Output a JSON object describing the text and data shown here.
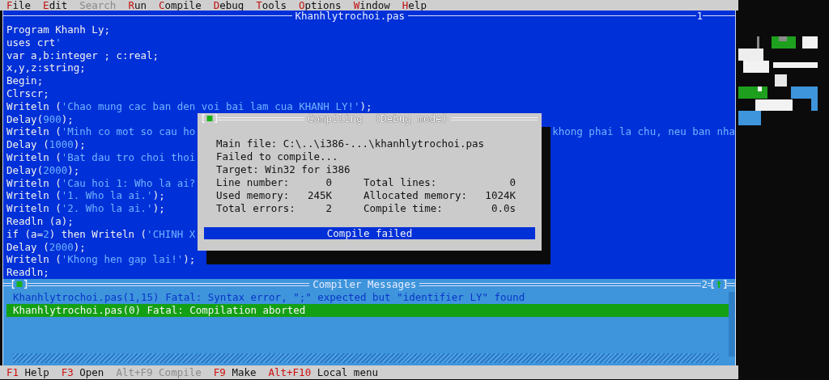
{
  "menu": [
    {
      "key": "F",
      "rest": "ile",
      "disabled": false
    },
    {
      "key": "E",
      "rest": "dit",
      "disabled": false
    },
    {
      "key": "S",
      "rest": "earch",
      "disabled": true
    },
    {
      "key": "R",
      "rest": "un",
      "disabled": false
    },
    {
      "key": "C",
      "rest": "ompile",
      "disabled": false
    },
    {
      "key": "D",
      "rest": "ebug",
      "disabled": false
    },
    {
      "key": "T",
      "rest": "ools",
      "disabled": false
    },
    {
      "key": "O",
      "rest": "ptions",
      "disabled": false
    },
    {
      "key": "W",
      "rest": "indow",
      "disabled": false
    },
    {
      "key": "H",
      "rest": "elp",
      "disabled": false
    }
  ],
  "editor": {
    "title": "Khanhlytrochoi.pas",
    "number": "1",
    "lines": [
      {
        "parts": [
          {
            "kind": "code",
            "text": "Program Khanh Ly;"
          }
        ]
      },
      {
        "parts": [
          {
            "kind": "code",
            "text": "uses crt"
          },
          {
            "kind": "literal",
            "text": "'"
          }
        ]
      },
      {
        "parts": [
          {
            "kind": "code",
            "text": "var a,b:integer ; c:real;"
          }
        ]
      },
      {
        "parts": [
          {
            "kind": "code",
            "text": "x,y,z:string;"
          }
        ]
      },
      {
        "parts": [
          {
            "kind": "code",
            "text": "Begin;"
          }
        ]
      },
      {
        "parts": [
          {
            "kind": "code",
            "text": "Clrscr;"
          }
        ]
      },
      {
        "parts": [
          {
            "kind": "code",
            "text": "Writeln ("
          },
          {
            "kind": "literal",
            "text": "'Chao mung cac ban den voi bai lam cua KHANH LY!'"
          },
          {
            "kind": "code",
            "text": ");"
          }
        ]
      },
      {
        "parts": [
          {
            "kind": "code",
            "text": "Delay("
          },
          {
            "kind": "literal",
            "text": "900"
          },
          {
            "kind": "code",
            "text": ");"
          }
        ]
      },
      {
        "parts": [
          {
            "kind": "code",
            "text": "Writeln ("
          },
          {
            "kind": "literal",
            "text": "'Minh co mot so cau ho"
          }
        ],
        "tail": "khong phai la chu, neu ban nha"
      },
      {
        "parts": [
          {
            "kind": "code",
            "text": "Delay ("
          },
          {
            "kind": "literal",
            "text": "1000"
          },
          {
            "kind": "code",
            "text": ");"
          }
        ]
      },
      {
        "parts": [
          {
            "kind": "code",
            "text": "Writeln ("
          },
          {
            "kind": "literal",
            "text": "'Bat dau tro choi thoi"
          }
        ]
      },
      {
        "parts": [
          {
            "kind": "code",
            "text": "Delay("
          },
          {
            "kind": "literal",
            "text": "2000"
          },
          {
            "kind": "code",
            "text": ");"
          }
        ]
      },
      {
        "parts": [
          {
            "kind": "code",
            "text": "Writeln ("
          },
          {
            "kind": "literal",
            "text": "'Cau hoi 1: Who la ai?"
          }
        ]
      },
      {
        "parts": [
          {
            "kind": "code",
            "text": "Writeln ("
          },
          {
            "kind": "literal",
            "text": "'1. Who la ai.'"
          },
          {
            "kind": "code",
            "text": ");"
          }
        ]
      },
      {
        "parts": [
          {
            "kind": "code",
            "text": "Writeln ("
          },
          {
            "kind": "literal",
            "text": "'2. Who la ai.'"
          },
          {
            "kind": "code",
            "text": ");"
          }
        ]
      },
      {
        "parts": [
          {
            "kind": "code",
            "text": "Readln (a);"
          }
        ]
      },
      {
        "parts": [
          {
            "kind": "code",
            "text": "if (a="
          },
          {
            "kind": "literal",
            "text": "2"
          },
          {
            "kind": "code",
            "text": ") then Writeln ("
          },
          {
            "kind": "literal",
            "text": "'CHINH X"
          }
        ]
      },
      {
        "parts": [
          {
            "kind": "code",
            "text": "Delay ("
          },
          {
            "kind": "literal",
            "text": "2000"
          },
          {
            "kind": "code",
            "text": ");"
          }
        ]
      },
      {
        "parts": [
          {
            "kind": "code",
            "text": "Writeln ("
          },
          {
            "kind": "literal",
            "text": "'Khong hen gap lai!'"
          },
          {
            "kind": "code",
            "text": ");"
          }
        ]
      },
      {
        "parts": [
          {
            "kind": "code",
            "text": "Readln;"
          }
        ]
      }
    ]
  },
  "dialog": {
    "title": "Compiling  (Debug mode)",
    "lines": [
      "Main file: C:\\..\\i386-...\\khanhlytrochoi.pas",
      "Failed to compile...",
      "Target: Win32 for i386"
    ],
    "stats": [
      {
        "label": "Line number:",
        "value": "0"
      },
      {
        "label": "Total lines:",
        "value": "0"
      },
      {
        "label": "Used memory:",
        "value": "245K"
      },
      {
        "label": "Allocated memory:",
        "value": "1024K"
      },
      {
        "label": "Total errors:",
        "value": "2"
      },
      {
        "label": "Compile time:",
        "value": "0.0s"
      }
    ],
    "status": "Compile failed"
  },
  "messages": {
    "title": "Compiler Messages",
    "number": "2",
    "items": [
      {
        "text": "Khanhlytrochoi.pas(1,15) Fatal: Syntax error, \";\" expected but \"identifier LY\" found",
        "selected": false
      },
      {
        "text": "Khanhlytrochoi.pas(0) Fatal: Compilation aborted",
        "selected": true
      }
    ]
  },
  "status_bar": [
    {
      "key": "F1",
      "label": "Help",
      "disabled": false
    },
    {
      "key": "F3",
      "label": "Open",
      "disabled": false
    },
    {
      "key": "Alt+F9",
      "label": "Compile",
      "disabled": true
    },
    {
      "key": "F9",
      "label": "Make",
      "disabled": false
    },
    {
      "key": "Alt+F10",
      "label": "Local menu",
      "disabled": false
    }
  ]
}
